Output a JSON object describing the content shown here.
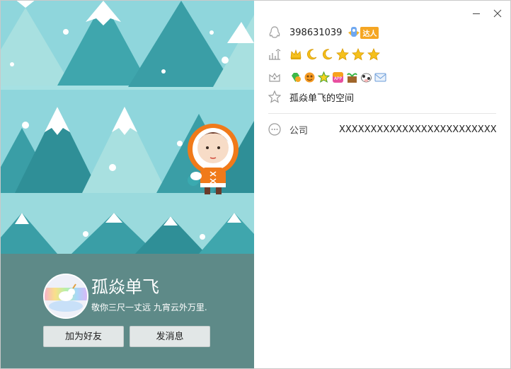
{
  "window": {
    "minimize_icon": "minimize-icon",
    "close_icon": "close-icon"
  },
  "profile": {
    "nickname": "孤焱单飞",
    "signature": "敬你三尺一丈远  九宵云外万里.",
    "add_friend_label": "加为好友",
    "send_message_label": "发消息"
  },
  "info": {
    "qq_number": "398631039",
    "vip_badge_text": "达人",
    "level_icons": [
      "crown",
      "moon",
      "moon",
      "star",
      "star",
      "star"
    ],
    "service_icons": [
      "green-diamond-icon",
      "orange-icon",
      "star-badge-icon",
      "app-icon",
      "farm-icon",
      "cow-icon",
      "mail-icon"
    ],
    "qzone_label": "孤焱单飞的空间",
    "company_label": "公司",
    "company_value": "XXXXXXXXXXXXXXXXXXXXXXXXX"
  },
  "colors": {
    "profile_bg": "#5e8a88",
    "sky": "#8fd6dc",
    "tree_dark": "#3a9ea6",
    "tree_light": "#a8e0e0"
  }
}
